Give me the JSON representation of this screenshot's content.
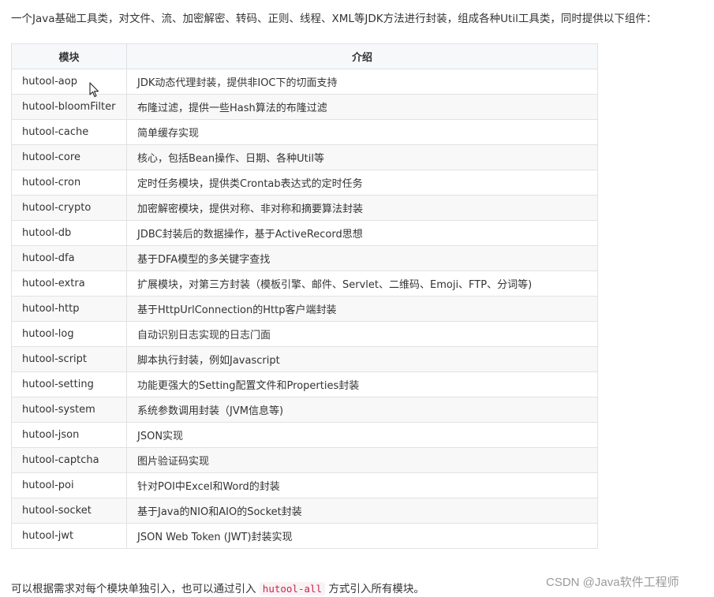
{
  "intro_text": "一个Java基础工具类，对文件、流、加密解密、转码、正则、线程、XML等JDK方法进行封装，组成各种Util工具类，同时提供以下组件：",
  "table": {
    "headers": [
      "模块",
      "介绍"
    ],
    "rows": [
      [
        "hutool-aop",
        "JDK动态代理封装，提供非IOC下的切面支持"
      ],
      [
        "hutool-bloomFilter",
        "布隆过滤，提供一些Hash算法的布隆过滤"
      ],
      [
        "hutool-cache",
        "简单缓存实现"
      ],
      [
        "hutool-core",
        "核心，包括Bean操作、日期、各种Util等"
      ],
      [
        "hutool-cron",
        "定时任务模块，提供类Crontab表达式的定时任务"
      ],
      [
        "hutool-crypto",
        "加密解密模块，提供对称、非对称和摘要算法封装"
      ],
      [
        "hutool-db",
        "JDBC封装后的数据操作，基于ActiveRecord思想"
      ],
      [
        "hutool-dfa",
        "基于DFA模型的多关键字查找"
      ],
      [
        "hutool-extra",
        "扩展模块，对第三方封装（模板引擎、邮件、Servlet、二维码、Emoji、FTP、分词等)"
      ],
      [
        "hutool-http",
        "基于HttpUrlConnection的Http客户端封装"
      ],
      [
        "hutool-log",
        "自动识别日志实现的日志门面"
      ],
      [
        "hutool-script",
        "脚本执行封装，例如Javascript"
      ],
      [
        "hutool-setting",
        "功能更强大的Setting配置文件和Properties封装"
      ],
      [
        "hutool-system",
        "系统参数调用封装（JVM信息等)"
      ],
      [
        "hutool-json",
        "JSON实现"
      ],
      [
        "hutool-captcha",
        "图片验证码实现"
      ],
      [
        "hutool-poi",
        "针对POI中Excel和Word的封装"
      ],
      [
        "hutool-socket",
        "基于Java的NIO和AIO的Socket封装"
      ],
      [
        "hutool-jwt",
        "JSON Web Token (JWT)封装实现"
      ]
    ]
  },
  "outro": {
    "before": "可以根据需求对每个模块单独引入，也可以通过引入",
    "code": "hutool-all",
    "after": "方式引入所有模块。"
  },
  "watermark": "CSDN @Java软件工程师",
  "colors": {
    "border": "#dfe2e5",
    "header_bg": "#f6f8fa",
    "stripe_bg": "#f8f8f8",
    "code_text": "#c7254e",
    "code_bg": "#f9f2f4"
  }
}
